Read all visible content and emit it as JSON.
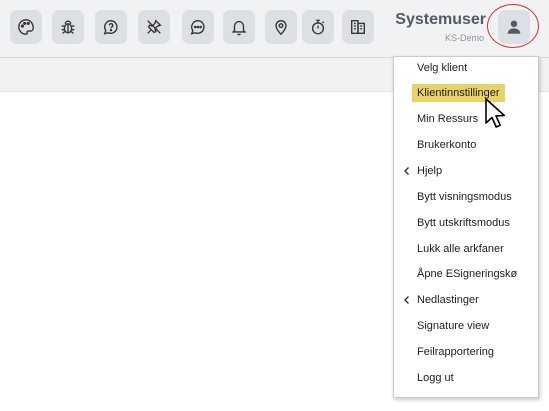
{
  "user": {
    "name": "Systemuser",
    "subtitle": "KS-Demo"
  },
  "toolbar_icons": [
    "palette-icon",
    "bug-icon",
    "help-bubble-icon",
    "disabled-pin-icon",
    "chat-icon",
    "bell-icon",
    "location-pin-icon",
    "stopwatch-icon",
    "building-icon"
  ],
  "menu": {
    "items": [
      {
        "label": "Velg klient"
      },
      {
        "label": "Klientinnstillinger",
        "highlighted": true
      },
      {
        "label": "Min Ressurs"
      },
      {
        "label": "Brukerkonto"
      },
      {
        "label": "Hjelp",
        "submenu": true
      },
      {
        "label": "Bytt visningsmodus"
      },
      {
        "label": "Bytt utskriftsmodus"
      },
      {
        "label": "Lukk alle arkfaner"
      },
      {
        "label": "Åpne ESigneringskø"
      },
      {
        "label": "Nedlastinger",
        "submenu": true
      },
      {
        "label": "Signature view"
      },
      {
        "label": "Feilrapportering"
      },
      {
        "label": "Logg ut"
      }
    ]
  },
  "colors": {
    "highlight": "#e8d36a",
    "avatar_ring": "#d0322b",
    "toolbar_bg": "#f1f2f4",
    "button_bg": "#dcdfe4"
  }
}
